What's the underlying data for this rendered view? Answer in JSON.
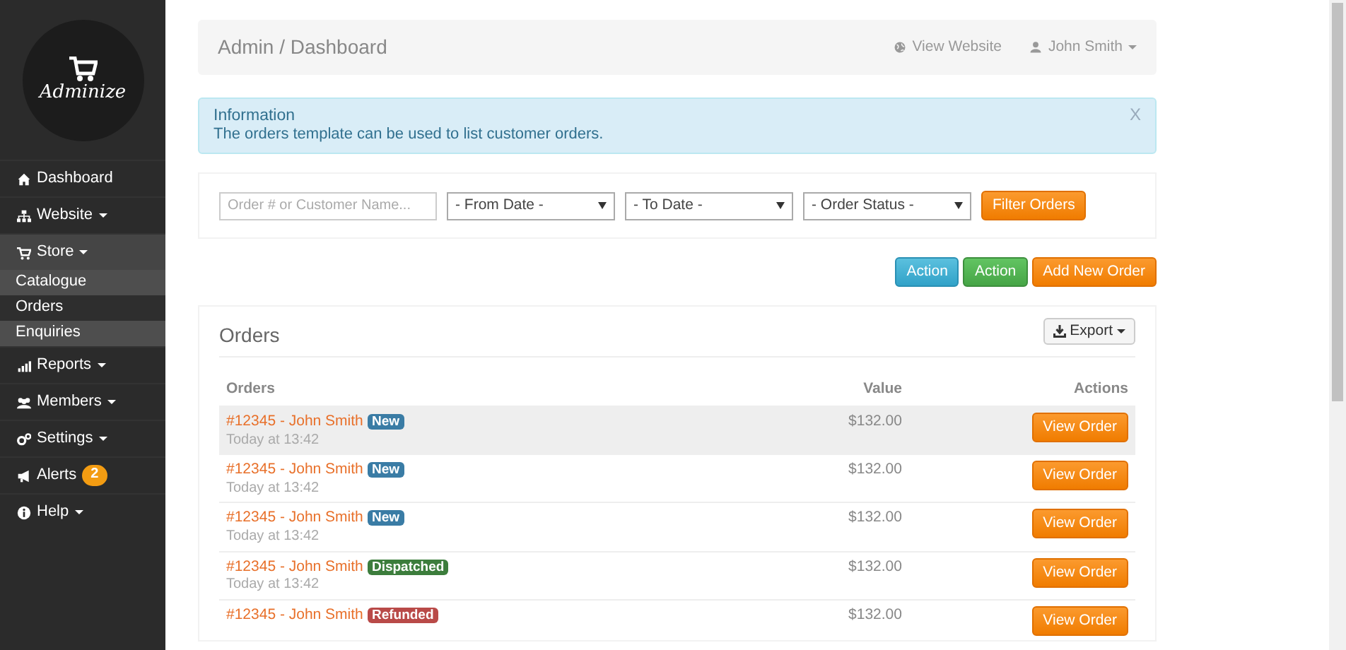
{
  "logo": {
    "text": "Adminize"
  },
  "sidebar": {
    "items": [
      {
        "label": "Dashboard",
        "dropdown": false,
        "expanded": false
      },
      {
        "label": "Website",
        "dropdown": true,
        "expanded": false
      },
      {
        "label": "Store",
        "dropdown": true,
        "expanded": true,
        "children": [
          {
            "label": "Catalogue",
            "shaded": true
          },
          {
            "label": "Orders",
            "shaded": false
          },
          {
            "label": "Enquiries",
            "shaded": true
          }
        ]
      },
      {
        "label": "Reports",
        "dropdown": true,
        "expanded": false
      },
      {
        "label": "Members",
        "dropdown": true,
        "expanded": false
      },
      {
        "label": "Settings",
        "dropdown": true,
        "expanded": false
      },
      {
        "label": "Alerts",
        "dropdown": false,
        "expanded": false,
        "badge": "2"
      },
      {
        "label": "Help",
        "dropdown": true,
        "expanded": false
      }
    ]
  },
  "breadcrumb": {
    "items": [
      "Admin",
      "Dashboard"
    ],
    "separator": "/"
  },
  "top_links": [
    {
      "label": "View Website",
      "dropdown": false
    },
    {
      "label": "John Smith",
      "dropdown": true
    }
  ],
  "alert": {
    "title": "Information",
    "message": "The orders template can be used to list customer orders.",
    "close": "X"
  },
  "filters": {
    "search": {
      "placeholder": "Order # or Customer Name..."
    },
    "selects": [
      {
        "value": "- From Date -"
      },
      {
        "value": "- To Date -"
      },
      {
        "value": "- Order Status -"
      }
    ],
    "button": "Filter Orders"
  },
  "actions": [
    {
      "label": "Action",
      "kind": "info"
    },
    {
      "label": "Action",
      "kind": "success"
    },
    {
      "label": "Add New Order",
      "kind": "warning"
    }
  ],
  "orders_panel": {
    "title": "Orders",
    "export": "Export",
    "table": {
      "columns": [
        "Orders",
        "Value",
        "Actions"
      ],
      "rows": [
        {
          "order": "#12345 - John Smith",
          "status": "New",
          "color": "#3a7ca5",
          "time": "Today at 13:42",
          "value": "$132.00",
          "action": "View Order",
          "highlighted": true
        },
        {
          "order": "#12345 - John Smith",
          "status": "New",
          "color": "#3a7ca5",
          "time": "Today at 13:42",
          "value": "$132.00",
          "action": "View Order",
          "highlighted": false
        },
        {
          "order": "#12345 - John Smith",
          "status": "New",
          "color": "#3a7ca5",
          "time": "Today at 13:42",
          "value": "$132.00",
          "action": "View Order",
          "highlighted": false
        },
        {
          "order": "#12345 - John Smith",
          "status": "Dispatched",
          "color": "#3c7d3c",
          "time": "Today at 13:42",
          "value": "$132.00",
          "action": "View Order",
          "highlighted": false
        },
        {
          "order": "#12345 - John Smith",
          "status": "Refunded",
          "color": "#b94a48",
          "value": "$132.00",
          "action": "View Order",
          "highlighted": false
        }
      ]
    }
  }
}
